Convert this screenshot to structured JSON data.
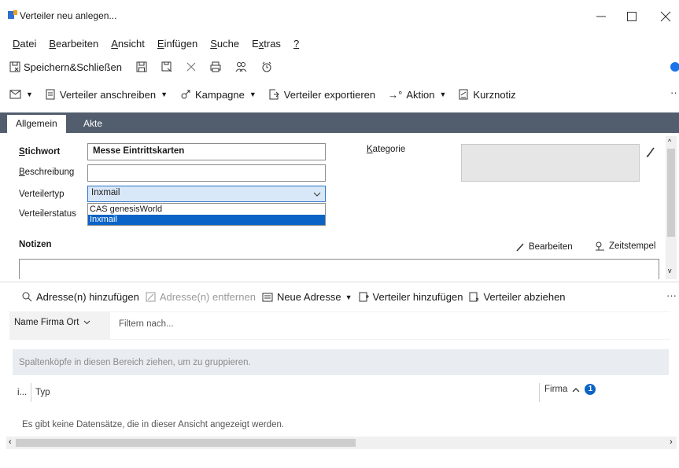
{
  "window": {
    "title": "Verteiler neu anlegen...",
    "controls": [
      "—",
      "☐",
      "✕"
    ]
  },
  "menu": {
    "items": [
      {
        "hot": "D",
        "rest": "atei"
      },
      {
        "hot": "B",
        "rest": "earbeiten"
      },
      {
        "hot": "A",
        "rest": "nsicht"
      },
      {
        "hot": "E",
        "rest": "infügen"
      },
      {
        "hot": "S",
        "rest": "uche"
      },
      {
        "pre": "E",
        "hot": "x",
        "rest": "tras"
      },
      {
        "hot": "?",
        "rest": ""
      }
    ]
  },
  "toolbar": {
    "save_close": "Speichern&Schließen"
  },
  "actionbar": {
    "write": "Verteiler anschreiben",
    "campaign": "Kampagne",
    "export": "Verteiler exportieren",
    "action": "Aktion",
    "note": "Kurznotiz"
  },
  "tabs": {
    "general": "Allgemein",
    "file": "Akte"
  },
  "form": {
    "stichwort_label": "Stichwort",
    "stichwort_value": "Messe Eintrittskarten",
    "beschreibung_label": "Beschreibung",
    "beschreibung_value": "",
    "typ_label": "Verteilertyp",
    "typ_value": "Inxmail",
    "typ_options": [
      "CAS genesisWorld",
      "Inxmail"
    ],
    "status_label": "Verteilerstatus",
    "kategorie_label": "Kategorie",
    "notes_label": "Notizen",
    "edit_label": "Bearbeiten",
    "timestamp_label": "Zeitstempel"
  },
  "grid": {
    "add_address": "Adresse(n) hinzufügen",
    "remove_address": "Adresse(n) entfernen",
    "new_address": "Neue Adresse",
    "add_list": "Verteiler hinzufügen",
    "remove_list": "Verteiler abziehen",
    "filter_scope": "Name Firma Ort",
    "filter_placeholder": "Filtern nach...",
    "group_hint": "Spaltenköpfe in diesen Bereich ziehen, um zu gruppieren.",
    "col_i": "i...",
    "col_typ": "Typ",
    "col_firma": "Firma",
    "sort_badge": "1",
    "empty_text": "Es gibt keine Datensätze, die in dieser Ansicht angezeigt werden."
  },
  "colors": {
    "tabbar": "#525e6e",
    "accent": "#0a64c8",
    "combo_bg": "#d9e8f8"
  }
}
